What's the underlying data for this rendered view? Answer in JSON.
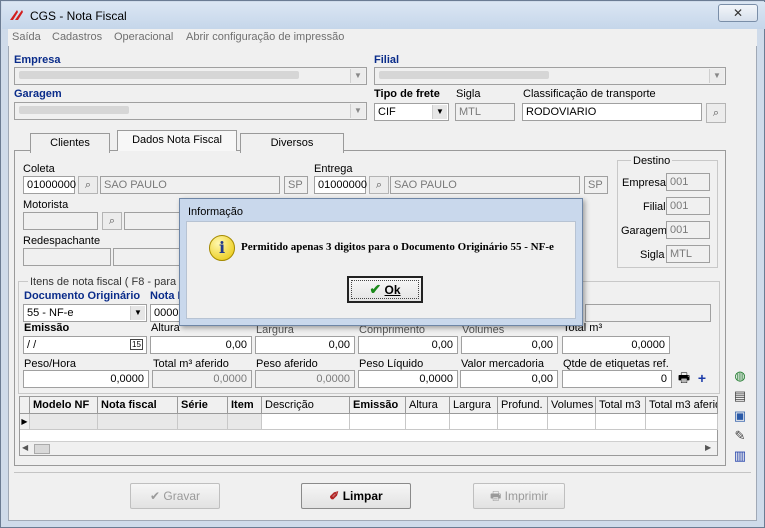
{
  "window": {
    "title": "CGS - Nota Fiscal",
    "close_glyph": "✕"
  },
  "menu": [
    "Saída",
    "Cadastros",
    "Operacional",
    "Abrir configuração de impressão"
  ],
  "header": {
    "empresa_label": "Empresa",
    "filial_label": "Filial",
    "garagem_label": "Garagem",
    "tipo_frete_label": "Tipo de frete",
    "tipo_frete_value": "CIF",
    "sigla_label": "Sigla",
    "sigla_value": "MTL",
    "classificacao_label": "Classificação de transporte",
    "classificacao_value": "RODOVIARIO"
  },
  "tabs": [
    {
      "label": "Clientes"
    },
    {
      "label": "Dados Nota Fiscal"
    },
    {
      "label": "Diversos"
    }
  ],
  "coleta": {
    "label": "Coleta",
    "code": "01000000",
    "city": "SAO PAULO",
    "uf": "SP"
  },
  "entrega": {
    "label": "Entrega",
    "code": "01000000",
    "city": "SAO PAULO",
    "uf": "SP"
  },
  "motorista_label": "Motorista",
  "redespachante_label": "Redespachante",
  "destino": {
    "title": "Destino",
    "empresa_label": "Empresa",
    "empresa_value": "001",
    "filial_label": "Filial",
    "filial_value": "001",
    "garagem_label": "Garagem",
    "garagem_value": "001",
    "sigla_label": "Sigla",
    "sigla_value": "MTL"
  },
  "itens": {
    "group_label": "Itens de nota fiscal ( F8 - para visu",
    "doc_orig_label": "Documento Originário",
    "doc_orig_value": "55 - NF-e",
    "nota_label": "Nota F",
    "nota_value": "00001",
    "emissao_label": "Emissão",
    "emissao_value": "/ /",
    "altura_label": "Altura",
    "altura_value": "0,00",
    "largura_label": "Largura",
    "largura_value": "0,00",
    "comprimento_label": "Comprimento",
    "comprimento_value": "0,00",
    "volumes_label": "Volumes",
    "volumes_value": "0,00",
    "m3_label": "Total m³",
    "m3_value": "0,0000",
    "peso_hora_label": "Peso/Hora",
    "peso_hora_value": "0,0000",
    "m3_aferido_label": "Total m³ aferido",
    "m3_aferido_value": "0,0000",
    "peso_aferido_label": "Peso aferido",
    "peso_aferido_value": "0,0000",
    "peso_liquido_label": "Peso Líquido",
    "peso_liquido_value": "0,0000",
    "valor_merc_label": "Valor mercadoria",
    "valor_merc_value": "0,00",
    "etiquetas_label": "Qtde de etiquetas ref.",
    "etiquetas_value": "0"
  },
  "grid": {
    "columns": [
      "Modelo NF",
      "Nota fiscal",
      "Série",
      "Item",
      "Descrição",
      "Emissão",
      "Altura",
      "Largura",
      "Profund.",
      "Volumes",
      "Total m3",
      "Total m3 aferido"
    ]
  },
  "buttons": {
    "gravar": "Gravar",
    "limpar": "Limpar",
    "imprimir": "Imprimir"
  },
  "dialog": {
    "title": "Informação",
    "message": "Permitido apenas 3 digitos para o Documento Originário 55 - NF-e",
    "ok": "Ok"
  }
}
